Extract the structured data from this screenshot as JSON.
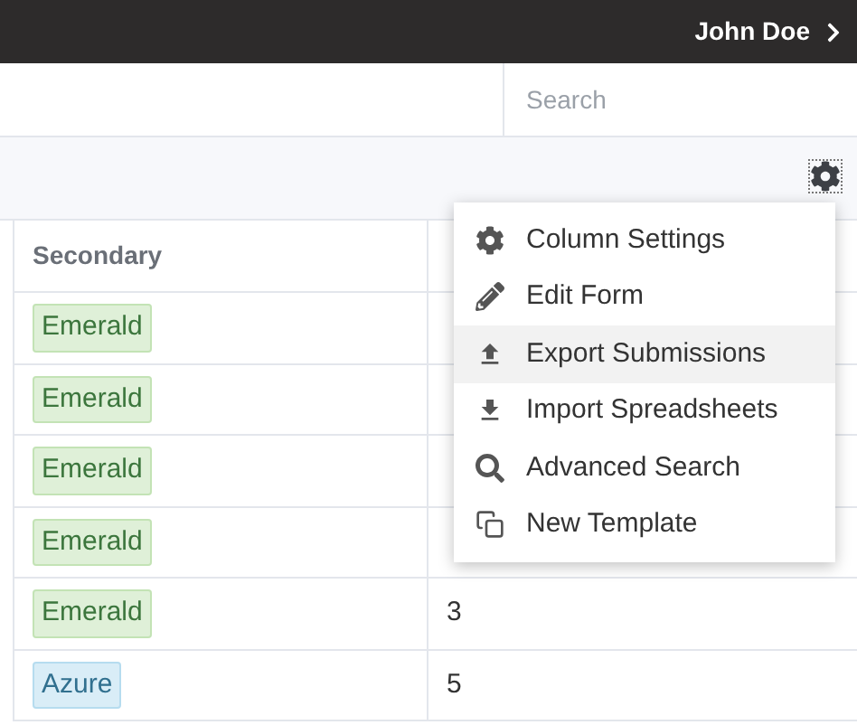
{
  "top_bar": {
    "user_name": "John Doe"
  },
  "search": {
    "placeholder": "Search"
  },
  "table": {
    "columns": [
      "Secondary"
    ],
    "rows": [
      {
        "secondary": {
          "label": "Emerald",
          "color": "#dff0d8"
        }
      },
      {
        "secondary": {
          "label": "Emerald",
          "color": "#dff0d8"
        }
      },
      {
        "secondary": {
          "label": "Emerald",
          "color": "#dff0d8"
        }
      },
      {
        "secondary": {
          "label": "Emerald",
          "color": "#dff0d8"
        }
      },
      {
        "secondary": {
          "label": "Emerald",
          "color": "#dff0d8"
        },
        "column_2": "3"
      },
      {
        "secondary": {
          "label": "Azure",
          "color": "#d9edf7"
        },
        "column_2": "5"
      }
    ]
  },
  "menu": {
    "items": [
      {
        "kind": "gear",
        "label": "Column Settings",
        "hovered": false
      },
      {
        "kind": "pencil",
        "label": "Edit Form",
        "hovered": false
      },
      {
        "kind": "upload",
        "label": "Export Submissions",
        "hovered": true
      },
      {
        "kind": "download",
        "label": "Import Spreadsheets",
        "hovered": false
      },
      {
        "kind": "search",
        "label": "Advanced Search",
        "hovered": false
      },
      {
        "kind": "copy",
        "label": "New Template",
        "hovered": false
      }
    ]
  }
}
